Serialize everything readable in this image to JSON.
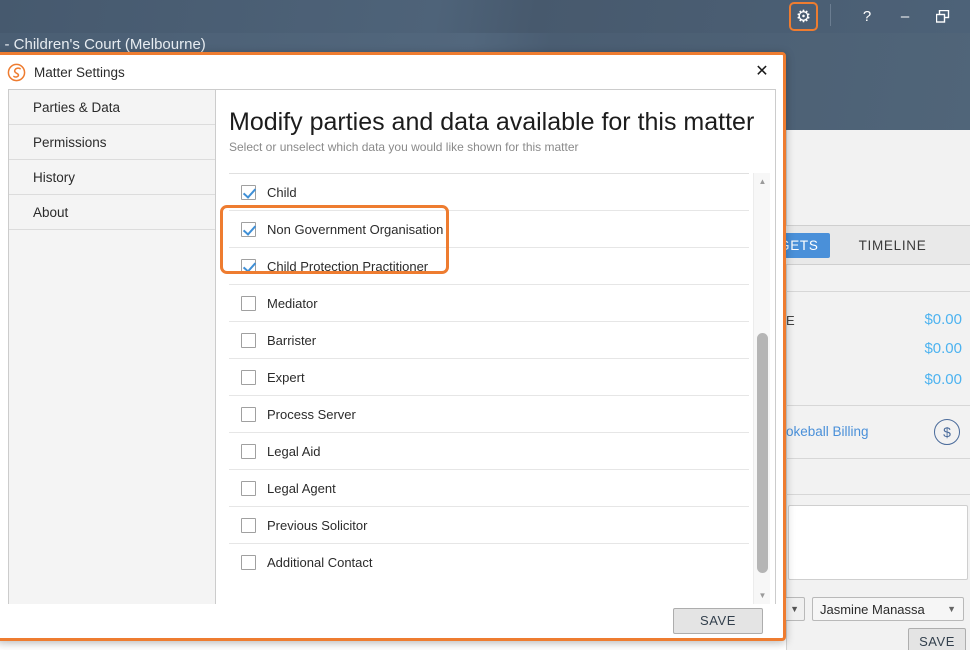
{
  "app": {
    "matter_title": "g - Children's Court (Melbourne)",
    "window_controls": {
      "settings_icon": "gear-icon",
      "help_label": "?",
      "minimize_label": "–",
      "restore_label": "❐"
    },
    "accent_orange": "#ee7c30",
    "header_blue": "#4d6278",
    "link_blue": "#4a90d9",
    "amount_blue": "#4db3f0"
  },
  "background_panel": {
    "tabs": [
      {
        "label": "GETS",
        "active": true
      },
      {
        "label": "TIMELINE",
        "active": false
      }
    ],
    "amount_row_label": "E",
    "amounts": [
      "$0.00",
      "$0.00",
      "$0.00"
    ],
    "billing_label": "okeball Billing",
    "billing_icon": "dollar-circle-icon",
    "name_dropdown_value": "Jasmine Manassa",
    "save_label": "SAVE"
  },
  "dialog": {
    "logo_icon": "smokeball-logo-icon",
    "title": "Matter Settings",
    "close_icon": "close-icon",
    "nav": [
      {
        "label": "Parties & Data",
        "selected": true
      },
      {
        "label": "Permissions",
        "selected": false
      },
      {
        "label": "History",
        "selected": false
      },
      {
        "label": "About",
        "selected": false
      }
    ],
    "heading": "Modify parties and data available for this matter",
    "subheading": "Select or unselect which data you would like shown for this matter",
    "options": [
      {
        "label": "Child",
        "checked": true,
        "highlighted": false
      },
      {
        "label": "Non Government Organisation",
        "checked": true,
        "highlighted": true
      },
      {
        "label": "Child Protection Practitioner",
        "checked": true,
        "highlighted": true
      },
      {
        "label": "Mediator",
        "checked": false,
        "highlighted": false
      },
      {
        "label": "Barrister",
        "checked": false,
        "highlighted": false
      },
      {
        "label": "Expert",
        "checked": false,
        "highlighted": false
      },
      {
        "label": "Process Server",
        "checked": false,
        "highlighted": false
      },
      {
        "label": "Legal Aid",
        "checked": false,
        "highlighted": false
      },
      {
        "label": "Legal Agent",
        "checked": false,
        "highlighted": false
      },
      {
        "label": "Previous Solicitor",
        "checked": false,
        "highlighted": false
      },
      {
        "label": "Additional Contact",
        "checked": false,
        "highlighted": false
      }
    ],
    "scrollbar": {
      "up_icon": "chevron-up-icon",
      "down_icon": "chevron-down-icon"
    },
    "save_label": "SAVE"
  }
}
